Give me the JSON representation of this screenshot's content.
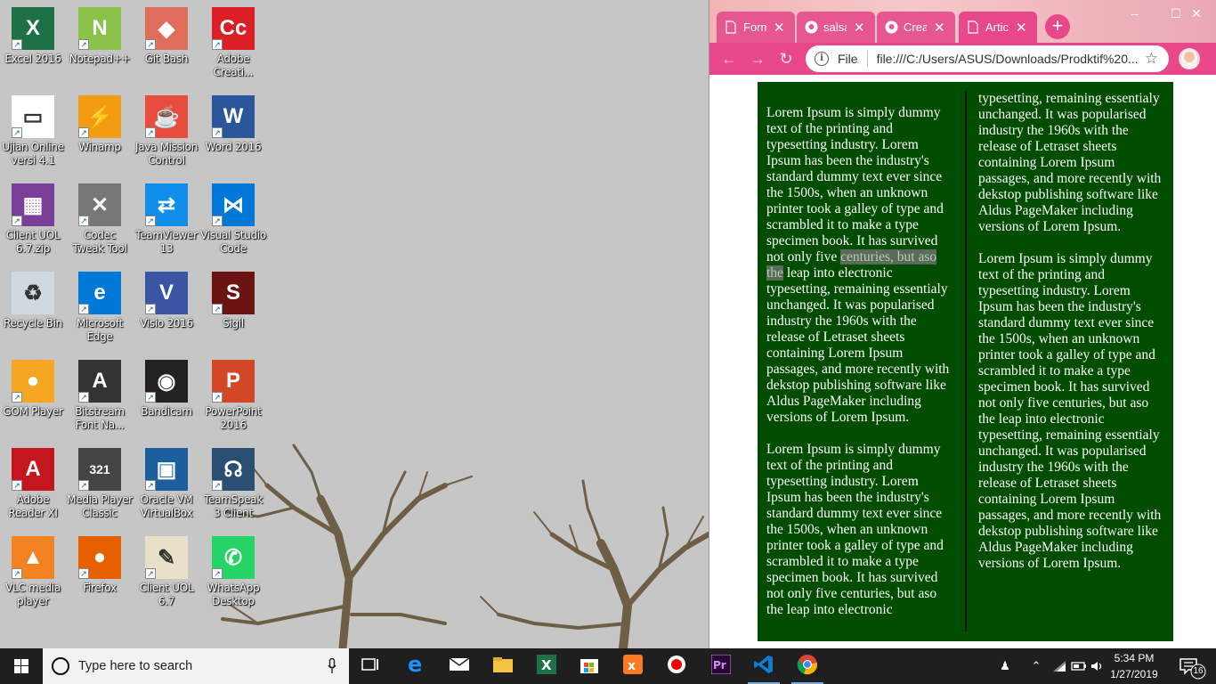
{
  "desktop": {
    "icons": [
      {
        "label": "Excel 2016",
        "icon": "excel-icon",
        "color": "#1e7145",
        "glyph": "X"
      },
      {
        "label": "Notepad++",
        "icon": "notepad-plus-plus-icon",
        "color": "#8bc34a",
        "glyph": "N"
      },
      {
        "label": "Git Bash",
        "icon": "git-bash-icon",
        "color": "#e06c5c",
        "glyph": "◆"
      },
      {
        "label": "Adobe Creati...",
        "icon": "adobe-creative-cloud-icon",
        "color": "#da1f26",
        "glyph": "Cc"
      },
      {
        "label": "Ujian Online versi 4.1",
        "icon": "ujian-online-icon",
        "color": "#ffffff",
        "glyph": "▭"
      },
      {
        "label": "Winamp",
        "icon": "winamp-icon",
        "color": "#f39c12",
        "glyph": "⚡"
      },
      {
        "label": "Java Mission Control",
        "icon": "java-mission-control-icon",
        "color": "#e74c3c",
        "glyph": "☕"
      },
      {
        "label": "Word 2016",
        "icon": "word-icon",
        "color": "#2b579a",
        "glyph": "W"
      },
      {
        "label": "Client UOL 6.7.zip",
        "icon": "winrar-icon",
        "color": "#7b3f99",
        "glyph": "▦"
      },
      {
        "label": "Codec Tweak Tool",
        "icon": "codec-tweak-tool-icon",
        "color": "#777777",
        "glyph": "✕"
      },
      {
        "label": "TeamViewer 13",
        "icon": "teamviewer-icon",
        "color": "#0e8ee9",
        "glyph": "⇄"
      },
      {
        "label": "Visual Studio Code",
        "icon": "vscode-icon",
        "color": "#0078d7",
        "glyph": "⋈"
      },
      {
        "label": "Recycle Bin",
        "icon": "recycle-bin-icon",
        "color": "#d0d8e0",
        "glyph": "♻"
      },
      {
        "label": "Microsoft Edge",
        "icon": "edge-icon",
        "color": "#0078d7",
        "glyph": "e"
      },
      {
        "label": "Visio 2016",
        "icon": "visio-icon",
        "color": "#3955a3",
        "glyph": "V"
      },
      {
        "label": "Sigil",
        "icon": "sigil-icon",
        "color": "#6b1414",
        "glyph": "S"
      },
      {
        "label": "GOM Player",
        "icon": "gom-player-icon",
        "color": "#f5a623",
        "glyph": "●"
      },
      {
        "label": "Bitstream Font Na...",
        "icon": "bitstream-font-navigator-icon",
        "color": "#333333",
        "glyph": "A"
      },
      {
        "label": "Bandicam",
        "icon": "bandicam-icon",
        "color": "#222222",
        "glyph": "◉"
      },
      {
        "label": "PowerPoint 2016",
        "icon": "powerpoint-icon",
        "color": "#d24726",
        "glyph": "P"
      },
      {
        "label": "Adobe Reader XI",
        "icon": "adobe-reader-icon",
        "color": "#c4161c",
        "glyph": "A"
      },
      {
        "label": "Media Player Classic",
        "icon": "media-player-classic-icon",
        "color": "#444444",
        "glyph": "321"
      },
      {
        "label": "Oracle VM VirtualBox",
        "icon": "virtualbox-icon",
        "color": "#1c5e9e",
        "glyph": "▣"
      },
      {
        "label": "TeamSpeak 3 Client",
        "icon": "teamspeak-icon",
        "color": "#2a4f72",
        "glyph": "☊"
      },
      {
        "label": "VLC media player",
        "icon": "vlc-icon",
        "color": "#f58220",
        "glyph": "▲"
      },
      {
        "label": "Firefox",
        "icon": "firefox-icon",
        "color": "#e66000",
        "glyph": "●"
      },
      {
        "label": "Client UOL 6.7",
        "icon": "client-uol-icon",
        "color": "#e8e0c8",
        "glyph": "✎"
      },
      {
        "label": "WhatsApp Desktop",
        "icon": "whatsapp-icon",
        "color": "#25d366",
        "glyph": "✆"
      }
    ]
  },
  "browser": {
    "tabs": [
      {
        "title": "Form",
        "icon": "page-icon",
        "active": false
      },
      {
        "title": "salsa",
        "icon": "github-icon",
        "active": false
      },
      {
        "title": "Creat",
        "icon": "github-icon",
        "active": false
      },
      {
        "title": "Artic",
        "icon": "page-icon",
        "active": true
      }
    ],
    "new_tab": "+",
    "scheme": "File",
    "url": "file:///C:/Users/ASUS/Downloads/Prodktif%20...",
    "article": {
      "col1": [
        [
          "Lorem Ipsum is simply dummy text of the printing and typesetting industry. Lorem Ipsum has been the industry's standard dummy text ever since the 1500s, when an unknown printer took a galley of type and scrambled it to make a type specimen book. It has survived not only five ",
          "centuries, but aso the",
          " leap into electronic typesetting, remaining essentialy unchanged. It was popularised industry the 1960s with the release of Letraset sheets containing Lorem Ipsum passages, and more recently with dekstop publishing software like Aldus PageMaker including versions of Lorem Ipsum."
        ],
        [
          "Lorem Ipsum is simply dummy text of the printing and typesetting industry. Lorem Ipsum has been the industry's standard dummy text ever since the 1500s, when an unknown printer took a galley of type and scrambled it to make a type specimen book. It has survived not only five centuries, but aso the leap into electronic",
          "",
          ""
        ]
      ],
      "col2": [
        "typesetting, remaining essentialy unchanged. It was popularised industry the 1960s with the release of Letraset sheets containing Lorem Ipsum passages, and more recently with dekstop publishing software like Aldus PageMaker including versions of Lorem Ipsum.",
        "Lorem Ipsum is simply dummy text of the printing and typesetting industry. Lorem Ipsum has been the industry's standard dummy text ever since the 1500s, when an unknown printer took a galley of type and scrambled it to make a type specimen book. It has survived not only five centuries, but aso the leap into electronic typesetting, remaining essentialy unchanged. It was popularised industry the 1960s with the release of Letraset sheets containing Lorem Ipsum passages, and more recently with dekstop publishing software like Aldus PageMaker including versions of Lorem Ipsum."
      ]
    }
  },
  "taskbar": {
    "search_placeholder": "Type here to search",
    "apps": [
      {
        "name": "task-view-icon",
        "running": false
      },
      {
        "name": "edge-icon",
        "running": false
      },
      {
        "name": "mail-icon",
        "running": false
      },
      {
        "name": "file-explorer-icon",
        "running": false
      },
      {
        "name": "excel-icon",
        "running": false
      },
      {
        "name": "store-icon",
        "running": false
      },
      {
        "name": "xampp-icon",
        "running": false
      },
      {
        "name": "record-icon",
        "running": false
      },
      {
        "name": "premiere-icon",
        "running": false
      },
      {
        "name": "vscode-icon",
        "running": true
      },
      {
        "name": "chrome-icon",
        "running": true
      }
    ],
    "time": "5:34 PM",
    "date": "1/27/2019",
    "notification_count": "16"
  },
  "colors": {
    "article_bg": "#004d00",
    "browser_accent": "#e8478a",
    "taskbar_bg": "#1f1f1f"
  }
}
